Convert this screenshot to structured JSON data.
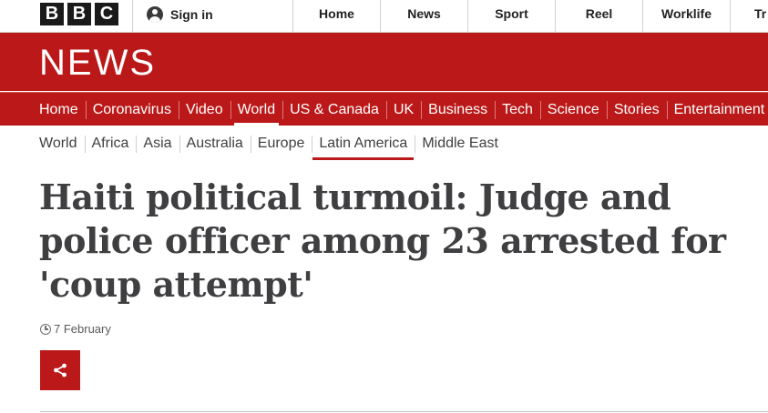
{
  "global_header": {
    "logo_letters": [
      "B",
      "B",
      "C"
    ],
    "signin_label": "Sign in",
    "nav": [
      "Home",
      "News",
      "Sport",
      "Reel",
      "Worklife",
      "Tr"
    ]
  },
  "masthead": {
    "title": "NEWS"
  },
  "news_nav": {
    "items": [
      "Home",
      "Coronavirus",
      "Video",
      "World",
      "US & Canada",
      "UK",
      "Business",
      "Tech",
      "Science",
      "Stories",
      "Entertainment"
    ],
    "active": "World"
  },
  "sub_nav": {
    "items": [
      "World",
      "Africa",
      "Asia",
      "Australia",
      "Europe",
      "Latin America",
      "Middle East"
    ],
    "active": "Latin America"
  },
  "article": {
    "headline": "Haiti political turmoil: Judge and police officer among 23 arrested for 'coup attempt'",
    "date": "7 February",
    "share_icon": "share-icon"
  },
  "colors": {
    "brand_red": "#bb1919",
    "headline": "#3f3f42"
  }
}
